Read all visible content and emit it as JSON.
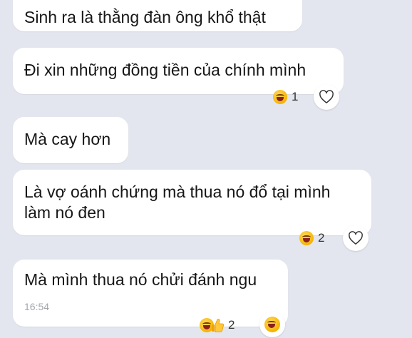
{
  "messages": [
    {
      "text": "Sinh ra là thằng đàn ông khổ thật"
    },
    {
      "text": "Đi xin những đồng tiền của chính mình",
      "reaction_count": "1"
    },
    {
      "text": "Mà cay hơn"
    },
    {
      "text": "Là vợ oánh chứng mà thua nó đổ tại mình làm nó đen",
      "reaction_count": "2"
    },
    {
      "text": "Mà mình thua nó chửi đánh ngu",
      "time": "16:54",
      "reaction_count": "2"
    }
  ],
  "icons": {
    "reaction_laugh": "laughing-face-icon",
    "reaction_like": "thumbs-up-icon",
    "react_button": "heart-outline-icon"
  },
  "colors": {
    "background": "#e3e6ee",
    "bubble": "#ffffff",
    "timestamp": "#a3a6ad"
  }
}
